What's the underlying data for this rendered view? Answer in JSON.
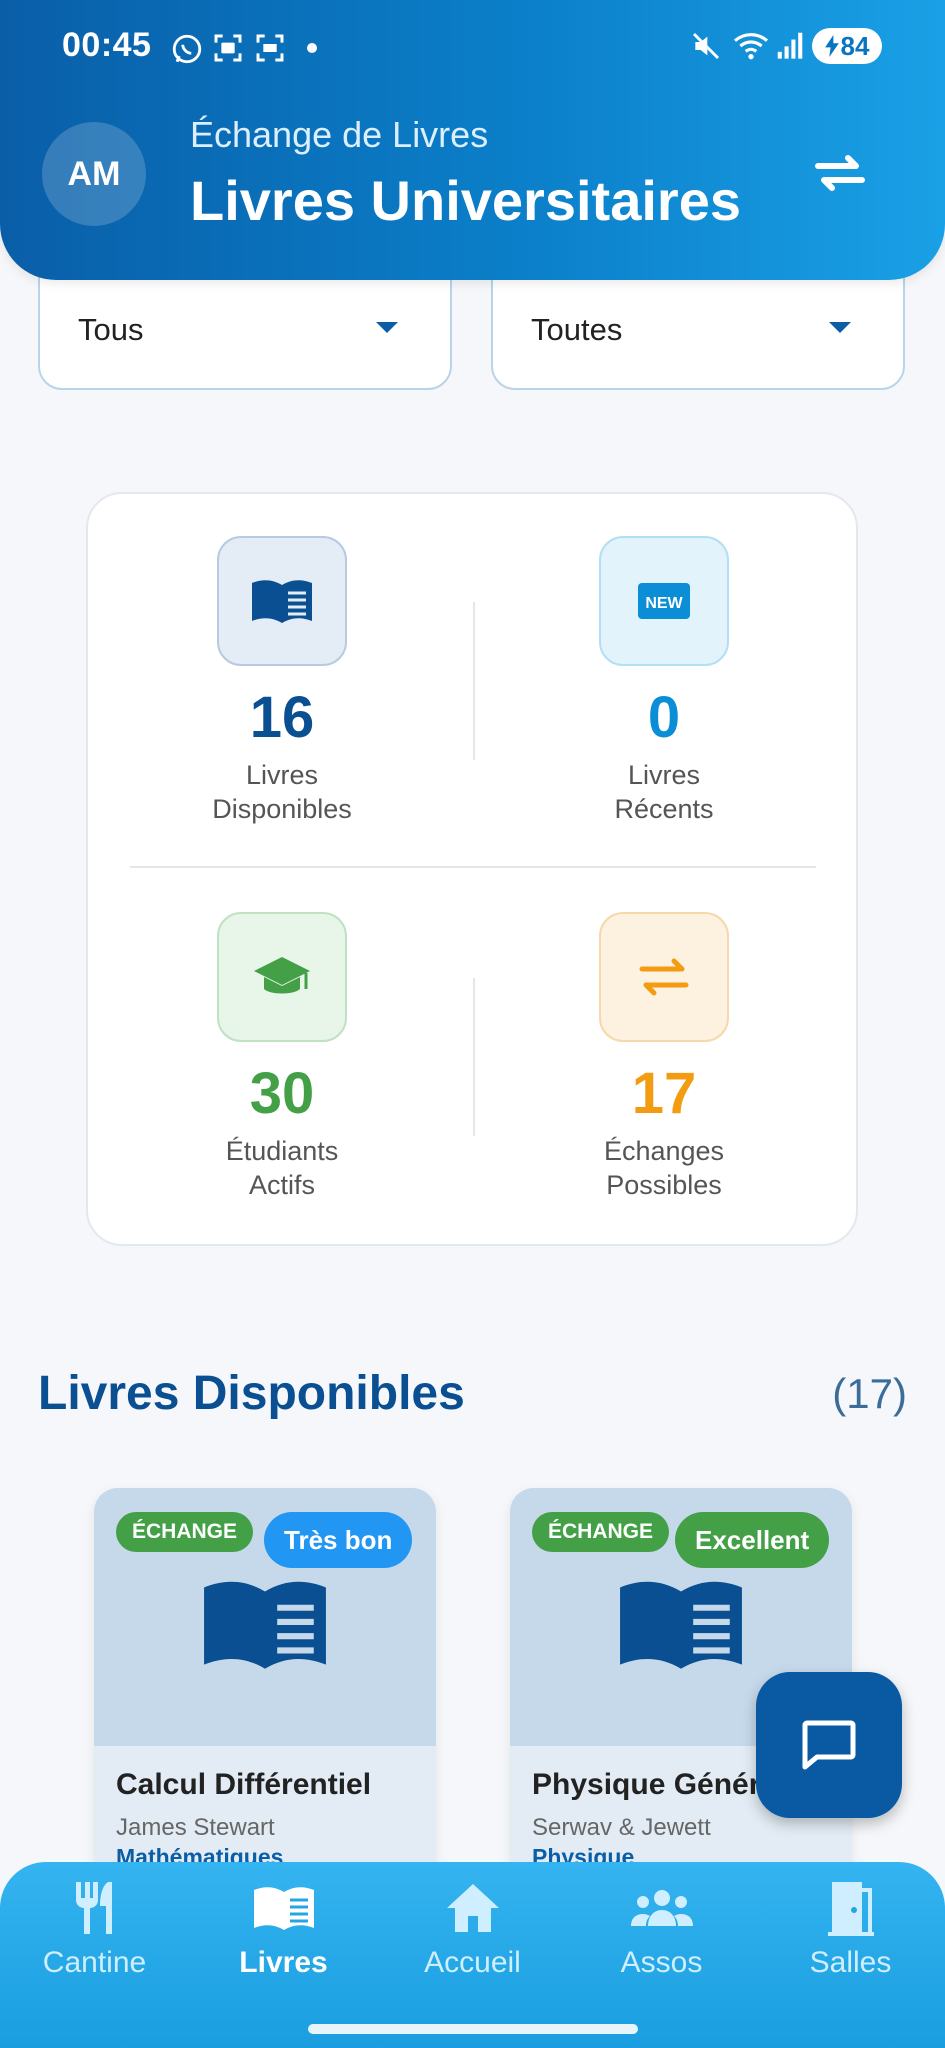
{
  "status_bar": {
    "time": "00:45",
    "battery": "84"
  },
  "header": {
    "avatar_initials": "AM",
    "subtitle": "Échange de Livres",
    "title": "Livres Universitaires"
  },
  "filters": [
    {
      "value": "Tous"
    },
    {
      "value": "Toutes"
    }
  ],
  "stats": [
    {
      "value": "16",
      "label_line1": "Livres",
      "label_line2": "Disponibles",
      "color": "#0a4f92",
      "icon": "book-icon"
    },
    {
      "value": "0",
      "label_line1": "Livres",
      "label_line2": "Récents",
      "color": "#0b8ed6",
      "icon": "new-icon"
    },
    {
      "value": "30",
      "label_line1": "Étudiants",
      "label_line2": "Actifs",
      "color": "#43a047",
      "icon": "graduation-cap-icon"
    },
    {
      "value": "17",
      "label_line1": "Échanges",
      "label_line2": "Possibles",
      "color": "#f39c12",
      "icon": "swap-icon"
    }
  ],
  "new_badge_text": "NEW",
  "section": {
    "title": "Livres Disponibles",
    "count": "(17)"
  },
  "books": [
    {
      "tag": "ÉCHANGE",
      "condition": "Très bon",
      "condition_color": "#2196f3",
      "title": "Calcul Différentiel",
      "author": "James Stewart",
      "subject": "Mathématiques"
    },
    {
      "tag": "ÉCHANGE",
      "condition": "Excellent",
      "condition_color": "#43a047",
      "title": "Physique Générale",
      "author": "Serwav & Jewett",
      "subject": "Physique"
    }
  ],
  "nav": [
    {
      "label": "Cantine",
      "icon": "fork-knife-icon"
    },
    {
      "label": "Livres",
      "icon": "book-icon",
      "active": true
    },
    {
      "label": "Accueil",
      "icon": "home-icon"
    },
    {
      "label": "Assos",
      "icon": "group-icon"
    },
    {
      "label": "Salles",
      "icon": "door-icon"
    }
  ]
}
